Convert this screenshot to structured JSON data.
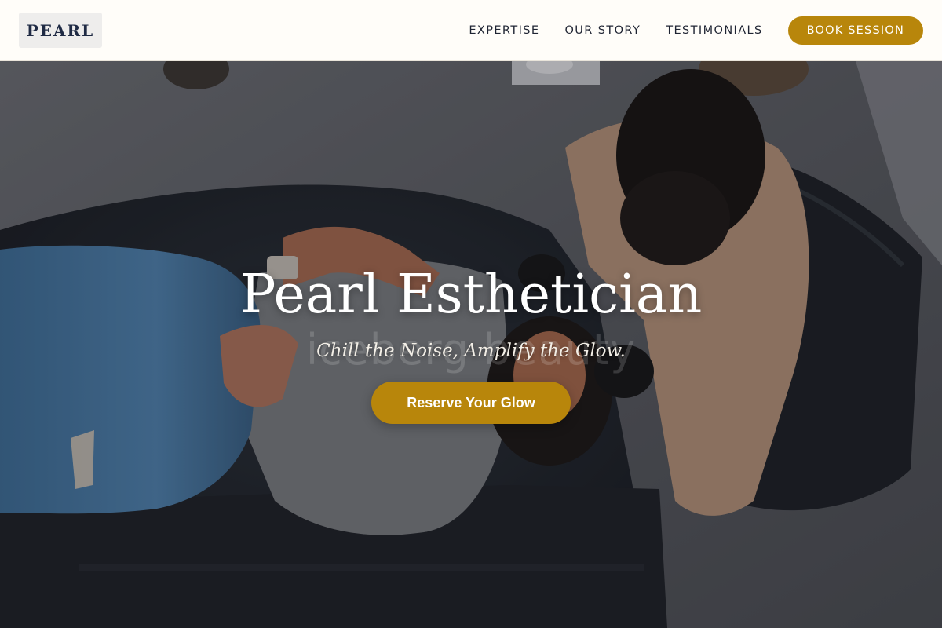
{
  "header": {
    "logo_text": "PEARL",
    "nav": [
      {
        "label": "EXPERTISE"
      },
      {
        "label": "OUR STORY"
      },
      {
        "label": "TESTIMONIALS"
      }
    ],
    "book_button": "BOOK SESSION"
  },
  "hero": {
    "title": "Pearl Esthetician",
    "ghost_text": "iceberg beauty",
    "subtitle": "Chill the Noise, Amplify the Glow.",
    "cta": "Reserve Your Glow"
  },
  "colors": {
    "accent": "#b8860b",
    "header_bg": "#fffdf9",
    "logo_text": "#1f2a44",
    "nav_text": "#1f2433"
  }
}
